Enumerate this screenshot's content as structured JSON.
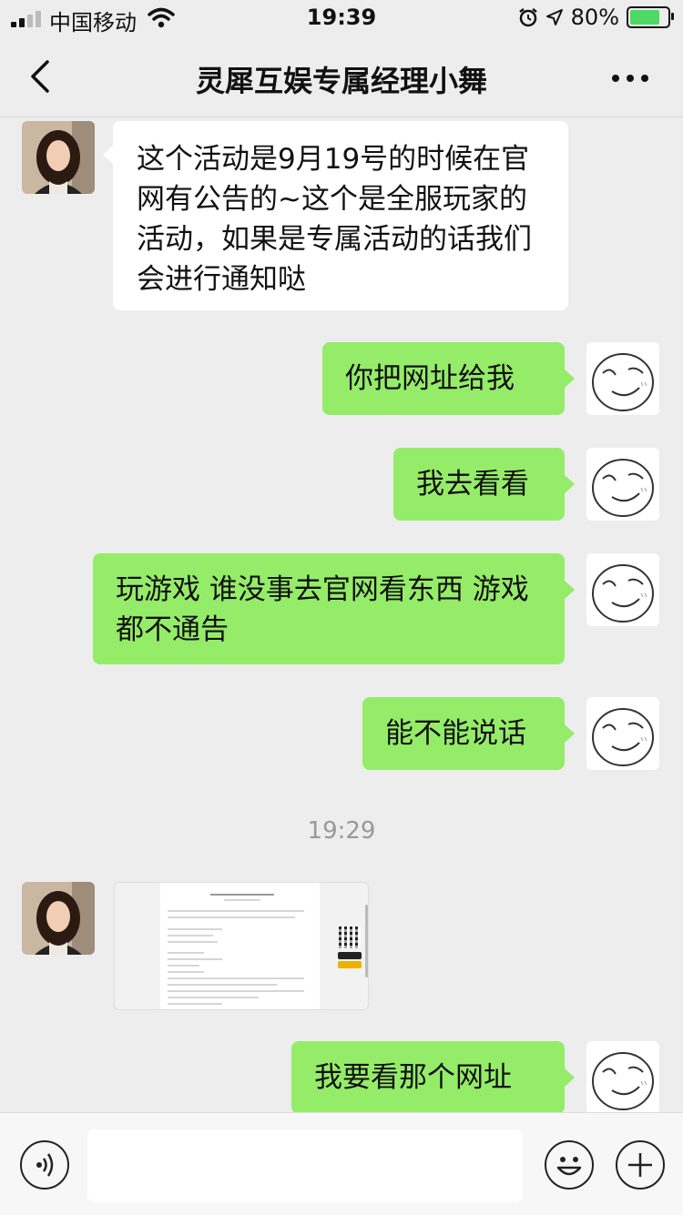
{
  "status": {
    "carrier": "中国移动",
    "time": "19:39",
    "battery": "80%",
    "battery_level": 0.8,
    "battery_color": "#4cd964"
  },
  "nav": {
    "title": "灵犀互娱专属经理小舞"
  },
  "messages": [
    {
      "from": "other",
      "text": "这个活动是9月19号的时候在官网有公告的~这个是全服玩家的活动，如果是专属活动的话我们会进行通知哒"
    },
    {
      "from": "me",
      "text": "你把网址给我"
    },
    {
      "from": "me",
      "text": "我去看看"
    },
    {
      "from": "me",
      "text": "玩游戏 谁没事去官网看东西 游戏都不通告"
    },
    {
      "from": "me",
      "text": "能不能说话"
    },
    {
      "from": "me",
      "text": "我要看那个网址"
    }
  ],
  "timestamp": "19:29",
  "colors": {
    "me_bubble": "#95ec69",
    "other_bubble": "#ffffff",
    "background": "#ededed"
  }
}
